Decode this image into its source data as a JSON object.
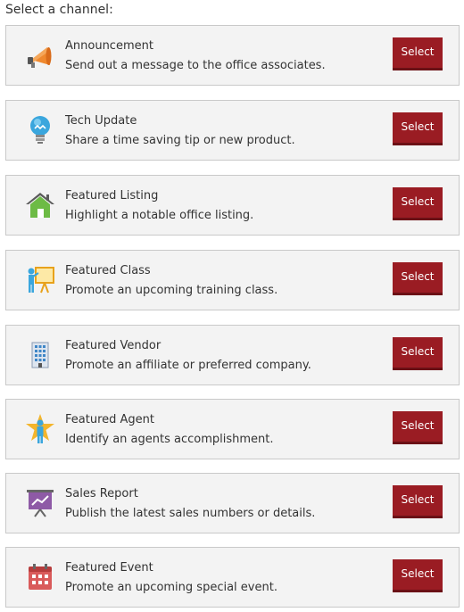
{
  "heading": "Select a channel:",
  "select_label": "Select",
  "channels": [
    {
      "title": "Announcement",
      "description": "Send out a message to the office associates.",
      "icon": "megaphone-icon"
    },
    {
      "title": "Tech Update",
      "description": "Share a time saving tip or new product.",
      "icon": "lightbulb-icon"
    },
    {
      "title": "Featured Listing",
      "description": "Highlight a notable office listing.",
      "icon": "house-icon"
    },
    {
      "title": "Featured Class",
      "description": "Promote an upcoming training class.",
      "icon": "presenter-icon"
    },
    {
      "title": "Featured Vendor",
      "description": "Promote an affiliate or preferred company.",
      "icon": "building-icon"
    },
    {
      "title": "Featured Agent",
      "description": "Identify an agents accomplishment.",
      "icon": "star-agent-icon"
    },
    {
      "title": "Sales Report",
      "description": "Publish the latest sales numbers or details.",
      "icon": "chart-board-icon"
    },
    {
      "title": "Featured Event",
      "description": "Promote an upcoming special event.",
      "icon": "calendar-icon"
    }
  ],
  "colors": {
    "button": "#9a1c23",
    "card_bg": "#f3f3f3",
    "card_border": "#c9c9c9"
  }
}
